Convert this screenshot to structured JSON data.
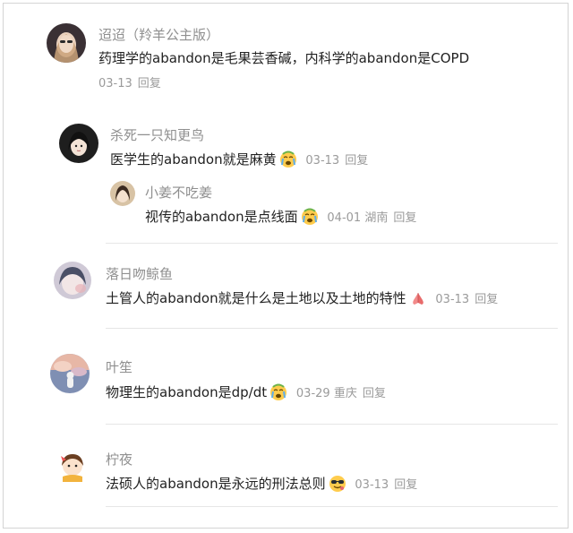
{
  "comments": [
    {
      "name": "迢迢（羚羊公主版）",
      "text": "药理学的abandon是毛果芸香碱，内科学的abandon是COPD",
      "date": "03-13",
      "location": "",
      "reply": "回复",
      "emoji": ""
    },
    {
      "name": "杀死一只知更鸟",
      "text": "医学生的abandon就是麻黄",
      "date": "03-13",
      "location": "",
      "reply": "回复",
      "emoji": "crying-face-icon"
    },
    {
      "name": "小姜不吃姜",
      "text": "视传的abandon是点线面",
      "date": "04-01",
      "location": "湖南",
      "reply": "回复",
      "emoji": "crying-face-icon"
    },
    {
      "name": "落日吻鲸鱼",
      "text": "土管人的abandon就是什么是土地以及土地的特性",
      "date": "03-13",
      "location": "",
      "reply": "回复",
      "emoji": "clasped-hands-icon"
    },
    {
      "name": "叶笙",
      "text": "物理生的abandon是dp/dt",
      "date": "03-29",
      "location": "重庆",
      "reply": "回复",
      "emoji": "crying-face-icon"
    },
    {
      "name": "柠夜",
      "text": "法硕人的abandon是永远的刑法总则",
      "date": "03-13",
      "location": "",
      "reply": "回复",
      "emoji": "sunglasses-face-icon"
    }
  ],
  "colors": {
    "name": "#8f8f8f",
    "text": "#222222",
    "meta": "#9a9a9a",
    "divider": "#e6e6e6"
  }
}
